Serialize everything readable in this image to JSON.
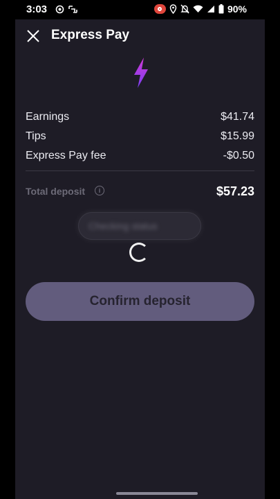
{
  "status_bar": {
    "time": "3:03",
    "battery": "90%"
  },
  "header": {
    "title": "Express Pay",
    "close_icon": "close-icon"
  },
  "logo_icon": "lightning-bolt-icon",
  "breakdown": [
    {
      "label": "Earnings",
      "value": "$41.74"
    },
    {
      "label": "Tips",
      "value": "$15.99"
    },
    {
      "label": "Express Pay fee",
      "value": "-$0.50"
    }
  ],
  "total": {
    "label": "Total deposit",
    "value": "$57.23"
  },
  "blurred_text": "Checking status",
  "confirm_label": "Confirm deposit",
  "colors": {
    "background": "#1e1c26",
    "button": "#625c7d",
    "accent_gradient": [
      "#c93bd9",
      "#7b3cf0"
    ]
  }
}
